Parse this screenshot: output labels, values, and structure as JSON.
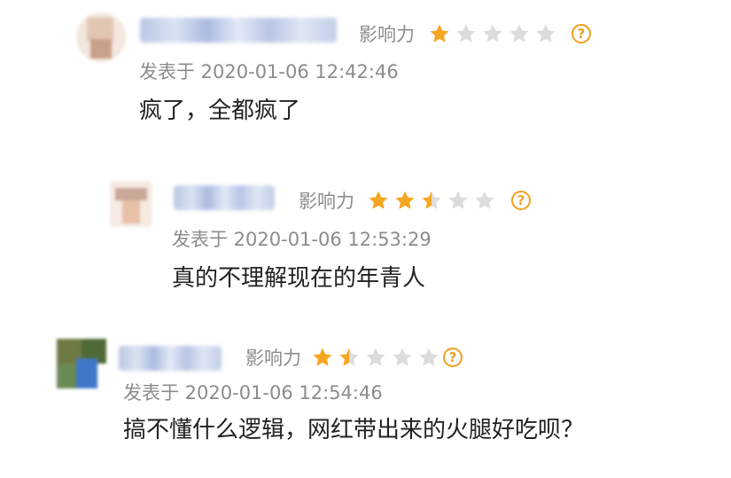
{
  "colors": {
    "star_filled": "#f5a623",
    "star_empty": "#dcdcdc",
    "muted_text": "#8c8c8c",
    "body_text": "#222222"
  },
  "comments": [
    {
      "influence_label": "影响力",
      "rating": 1,
      "max_rating": 5,
      "help_glyph": "?",
      "date": "发表于 2020-01-06 12:42:46",
      "text": "疯了，全都疯了"
    },
    {
      "influence_label": "影响力",
      "rating": 2.5,
      "max_rating": 5,
      "help_glyph": "?",
      "date": "发表于 2020-01-06 12:53:29",
      "text": "真的不理解现在的年青人"
    },
    {
      "influence_label": "影响力",
      "rating": 1.5,
      "max_rating": 5,
      "help_glyph": "?",
      "date": "发表于 2020-01-06 12:54:46",
      "text": "搞不懂什么逻辑，网红带出来的火腿好吃呗？"
    }
  ]
}
